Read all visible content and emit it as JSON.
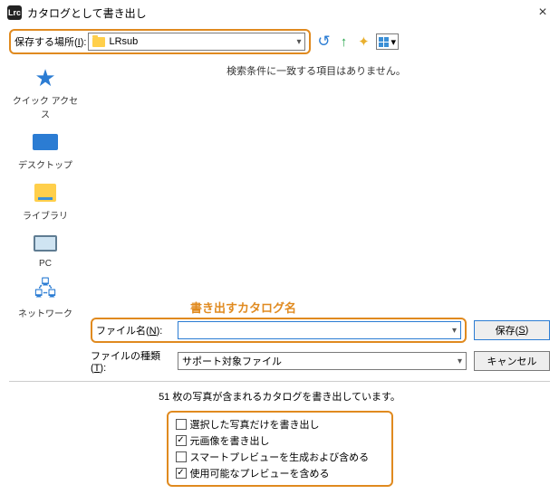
{
  "window": {
    "app_icon_label": "Lrc",
    "title": "カタログとして書き出し"
  },
  "location": {
    "label_prefix": "保存する場所(",
    "label_underline": "I",
    "label_suffix": "):",
    "folder_name": "LRsub"
  },
  "nav_icons": {
    "back": "back-icon",
    "up": "up-icon",
    "newfolder": "new-folder-icon",
    "view": "view-menu-icon"
  },
  "places": {
    "quick_access": "クイック アクセス",
    "desktop": "デスクトップ",
    "libraries": "ライブラリ",
    "pc": "PC",
    "network": "ネットワーク"
  },
  "fileview": {
    "empty_msg": "検索条件に一致する項目はありません。"
  },
  "annotation": "書き出すカタログ名",
  "form": {
    "filename_label_prefix": "ファイル名(",
    "filename_label_underline": "N",
    "filename_label_suffix": "):",
    "filename_value": "",
    "filetype_label_prefix": "ファイルの種類(",
    "filetype_label_underline": "T",
    "filetype_label_suffix": "):",
    "filetype_value": "サポート対象ファイル",
    "save_btn_prefix": "保存(",
    "save_btn_underline": "S",
    "save_btn_suffix": ")",
    "cancel_btn": "キャンセル"
  },
  "summary": "51 枚の写真が含まれるカタログを書き出しています。",
  "options": [
    {
      "label": "選択した写真だけを書き出し",
      "checked": false
    },
    {
      "label": "元画像を書き出し",
      "checked": true
    },
    {
      "label": "スマートプレビューを生成および含める",
      "checked": false
    },
    {
      "label": "使用可能なプレビューを含める",
      "checked": true
    }
  ]
}
